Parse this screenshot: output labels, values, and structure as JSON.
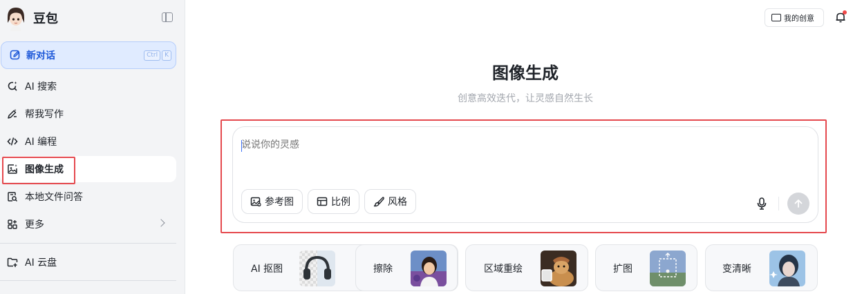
{
  "sidebar": {
    "brand": "豆包",
    "new_chat": {
      "label": "新对话",
      "shortcut": [
        "Ctrl",
        "K"
      ]
    },
    "items": [
      {
        "label": "AI 搜索",
        "icon": "search-sparkle-icon"
      },
      {
        "label": "帮我写作",
        "icon": "pen-icon"
      },
      {
        "label": "AI 编程",
        "icon": "code-icon"
      },
      {
        "label": "图像生成",
        "icon": "image-gen-icon",
        "active": true
      },
      {
        "label": "本地文件问答",
        "icon": "file-search-icon"
      },
      {
        "label": "更多",
        "icon": "grid-icon"
      }
    ],
    "cloud": {
      "label": "AI 云盘",
      "icon": "cloud-folder-icon"
    }
  },
  "header": {
    "my_creations": "我的创意"
  },
  "main": {
    "title": "图像生成",
    "subtitle": "创意高效迭代，让灵感自然生长",
    "input": {
      "placeholder": "说说你的灵感",
      "value": ""
    },
    "chips": [
      {
        "label": "参考图",
        "icon": "image-icon"
      },
      {
        "label": "比例",
        "icon": "ratio-icon"
      },
      {
        "label": "风格",
        "icon": "brush-icon"
      }
    ],
    "tools": [
      {
        "label": "AI 抠图",
        "thumb": "headphones-cutout"
      },
      {
        "label": "擦除",
        "thumb": "girl-portrait"
      },
      {
        "label": "区域重绘",
        "thumb": "dog-photo"
      },
      {
        "label": "扩图",
        "thumb": "landscape-expand"
      },
      {
        "label": "变清晰",
        "thumb": "portrait-sharpen"
      }
    ]
  },
  "colors": {
    "accent": "#1c57d8",
    "highlight": "#e5484d",
    "sidebar_bg": "#f3f4f6"
  }
}
